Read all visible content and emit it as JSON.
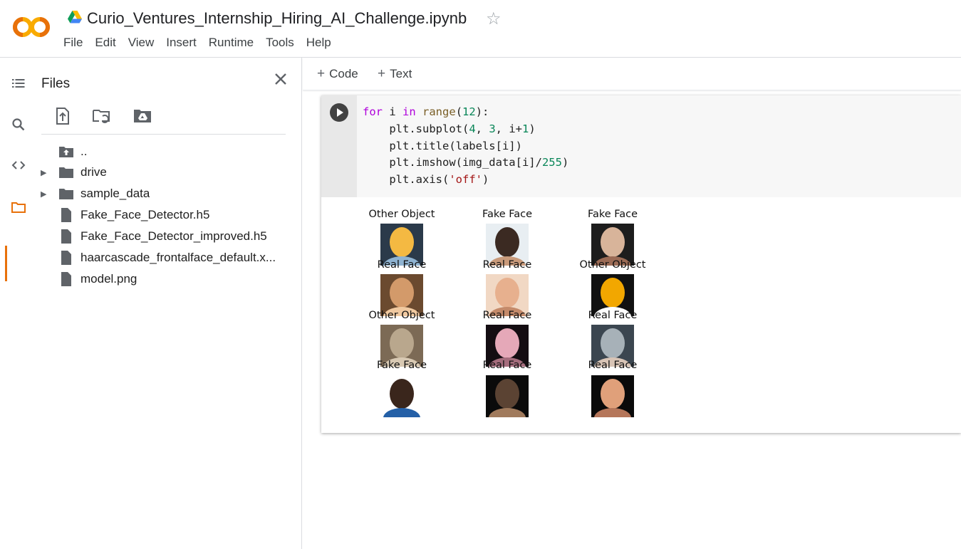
{
  "header": {
    "notebook_title": "Curio_Ventures_Internship_Hiring_AI_Challenge.ipynb",
    "logo_text": "CO",
    "menu": [
      "File",
      "Edit",
      "View",
      "Insert",
      "Runtime",
      "Tools",
      "Help"
    ]
  },
  "rail": {
    "items": [
      "table-of-contents-icon",
      "search-icon",
      "code-snippets-icon",
      "folder-icon"
    ],
    "active": "folder-icon"
  },
  "files_panel": {
    "title": "Files",
    "toolbar": [
      "upload-file-icon",
      "refresh-folder-icon",
      "mount-drive-icon"
    ],
    "items": [
      {
        "label": "..",
        "type": "parent",
        "expandable": false
      },
      {
        "label": "drive",
        "type": "folder",
        "expandable": true
      },
      {
        "label": "sample_data",
        "type": "folder",
        "expandable": true
      },
      {
        "label": "Fake_Face_Detector.h5",
        "type": "file",
        "expandable": false
      },
      {
        "label": "Fake_Face_Detector_improved.h5",
        "type": "file",
        "expandable": false
      },
      {
        "label": "haarcascade_frontalface_default.x...",
        "type": "file",
        "expandable": false
      },
      {
        "label": "model.png",
        "type": "file",
        "expandable": false
      }
    ]
  },
  "toolbar": {
    "add_code": "Code",
    "add_text": "Text"
  },
  "cell": {
    "code_lines": [
      "for i in range(12):",
      "    plt.subplot(4, 3, i+1)",
      "    plt.title(labels[i])",
      "    plt.imshow(img_data[i]/255)",
      "    plt.axis('off')"
    ],
    "output_titles": [
      "Other Object",
      "Fake Face",
      "Fake Face",
      "Real Face",
      "Real Face",
      "Other Object",
      "Other Object",
      "Real Face",
      "Real Face",
      "Fake Face",
      "Real Face",
      "Real Face"
    ],
    "output_images": [
      "robot-image",
      "bearded-man-image",
      "cgi-face-image",
      "man-portrait-image",
      "woman-portrait-image",
      "cartoon-face-image",
      "clock-image",
      "blurred-face-image",
      "man-grayscale-image",
      "smiling-man-image",
      "dark-portrait-image",
      "bald-cgi-face-image"
    ]
  }
}
